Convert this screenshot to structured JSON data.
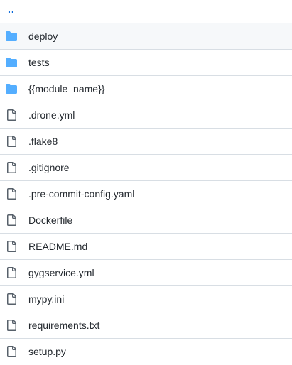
{
  "parent_link": "..",
  "entries": [
    {
      "name": "deploy",
      "type": "folder",
      "icon": "folder-icon"
    },
    {
      "name": "tests",
      "type": "folder",
      "icon": "folder-icon"
    },
    {
      "name": "{{module_name}}",
      "type": "folder",
      "icon": "folder-icon"
    },
    {
      "name": ".drone.yml",
      "type": "file",
      "icon": "file-icon"
    },
    {
      "name": ".flake8",
      "type": "file",
      "icon": "file-icon"
    },
    {
      "name": ".gitignore",
      "type": "file",
      "icon": "file-icon"
    },
    {
      "name": ".pre-commit-config.yaml",
      "type": "file",
      "icon": "file-icon"
    },
    {
      "name": "Dockerfile",
      "type": "file",
      "icon": "file-icon"
    },
    {
      "name": "README.md",
      "type": "file",
      "icon": "file-icon"
    },
    {
      "name": "gygservice.yml",
      "type": "file",
      "icon": "file-icon"
    },
    {
      "name": "mypy.ini",
      "type": "file",
      "icon": "file-icon"
    },
    {
      "name": "requirements.txt",
      "type": "file",
      "icon": "file-icon"
    },
    {
      "name": "setup.py",
      "type": "file",
      "icon": "file-icon"
    }
  ],
  "colors": {
    "folder": "#54aeff",
    "file": "#57606a",
    "link": "#0969da",
    "row_hover": "#f6f8fa",
    "border": "#d8dee4"
  }
}
